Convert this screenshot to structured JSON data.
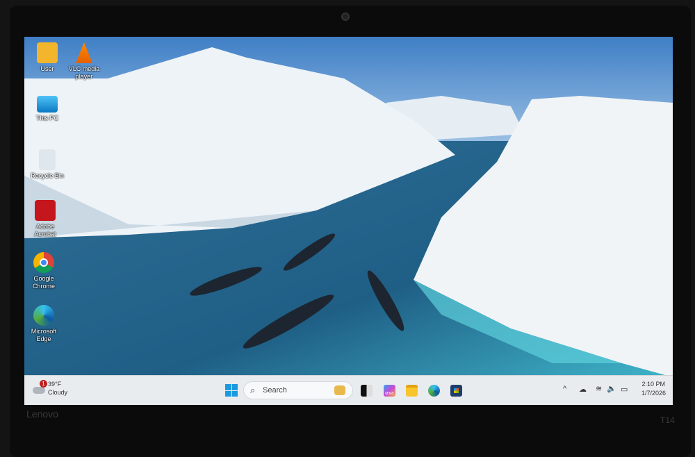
{
  "desktop_icons": [
    {
      "label": "User",
      "icon": "folder-user-icon"
    },
    {
      "label": "VLC media player",
      "icon": "vlc-icon"
    },
    {
      "label": "This PC",
      "icon": "monitor-icon"
    },
    {
      "label": "Recycle Bin",
      "icon": "recycle-bin-icon"
    },
    {
      "label": "Adobe Acrobat",
      "icon": "acrobat-icon"
    },
    {
      "label": "Google Chrome",
      "icon": "chrome-icon"
    },
    {
      "label": "Microsoft Edge",
      "icon": "edge-icon"
    }
  ],
  "weather": {
    "temp": "39°F",
    "condition": "Cloudy",
    "badge": "1"
  },
  "search": {
    "placeholder": "Search"
  },
  "taskbar_apps": [
    "task-view",
    "microsoft-365",
    "file-explorer",
    "edge",
    "store"
  ],
  "taskbar_app_labels": {
    "m365": "M365"
  },
  "clock": {
    "time": "2:10 PM",
    "date": "1/7/2026"
  },
  "bezel": {
    "brand": "Lenovo",
    "model": "T14"
  }
}
